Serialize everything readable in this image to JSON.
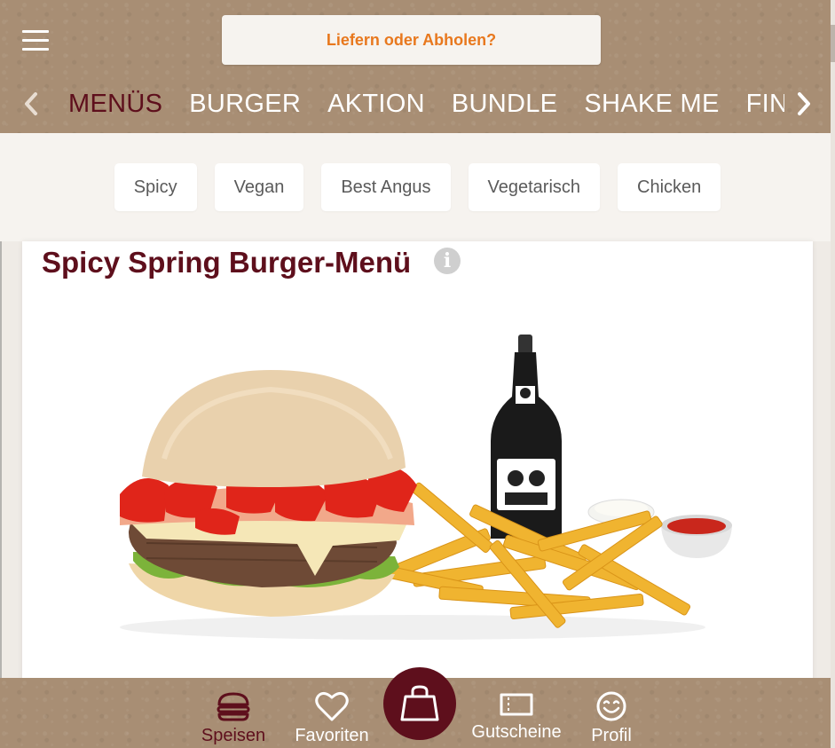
{
  "header": {
    "delivery_button_label": "Liefern oder Abholen?",
    "menu_icon": "hamburger-menu-icon"
  },
  "categories": {
    "tabs": [
      {
        "label": "MENÜS",
        "active": true
      },
      {
        "label": "BURGER",
        "active": false
      },
      {
        "label": "AKTION",
        "active": false
      },
      {
        "label": "BUNDLE",
        "active": false
      },
      {
        "label": "SHAKE ME",
        "active": false
      },
      {
        "label": "FINGER",
        "active": false
      }
    ],
    "prev_icon": "chevron-left-icon",
    "next_icon": "chevron-right-icon"
  },
  "filters": {
    "chips": [
      "Spicy",
      "Vegan",
      "Best Angus",
      "Vegetarisch",
      "Chicken"
    ]
  },
  "product": {
    "title": "Spicy Spring Burger-Menü",
    "info_icon_glyph": "i",
    "image_icon": "burger-menu-meal-image"
  },
  "bottom_nav": {
    "items": [
      {
        "label": "Speisen",
        "icon": "burger-icon",
        "active": true
      },
      {
        "label": "Favoriten",
        "icon": "heart-icon",
        "active": false
      },
      {
        "label": "Gutscheine",
        "icon": "voucher-ticket-icon",
        "active": false
      },
      {
        "label": "Profil",
        "icon": "smiley-icon",
        "active": false
      }
    ],
    "cart_icon": "shopping-bag-icon"
  },
  "colors": {
    "brand": "#5e0f1c",
    "accent": "#e8781e",
    "kraft": "#a88e74"
  }
}
